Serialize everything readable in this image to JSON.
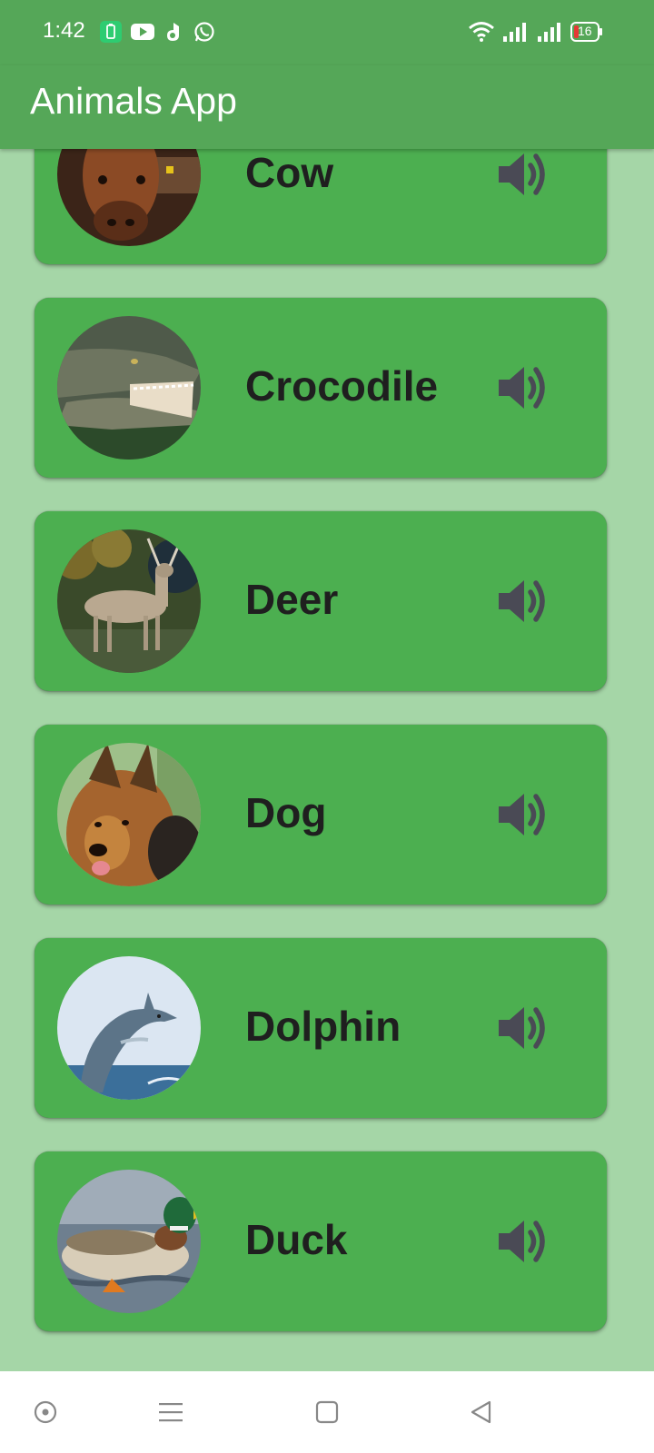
{
  "status_bar": {
    "time": "1:42",
    "battery_level": "16",
    "notification_icons": [
      "battery-saver-icon",
      "youtube-icon",
      "app-notification-icon",
      "whatsapp-icon"
    ],
    "system_icons": [
      "wifi-icon",
      "signal-icon",
      "signal-icon",
      "battery-icon"
    ]
  },
  "app_bar": {
    "title": "Animals App"
  },
  "colors": {
    "app_bar": "#55a758",
    "card": "#4caf50",
    "background": "#a5d6a7",
    "icon": "#4a4a55",
    "text": "#1f1f1f"
  },
  "animals": [
    {
      "name": "Cow",
      "image": "cow-photo",
      "sound_icon": "volume-up-icon"
    },
    {
      "name": "Crocodile",
      "image": "crocodile-photo",
      "sound_icon": "volume-up-icon"
    },
    {
      "name": "Deer",
      "image": "deer-photo",
      "sound_icon": "volume-up-icon"
    },
    {
      "name": "Dog",
      "image": "dog-photo",
      "sound_icon": "volume-up-icon"
    },
    {
      "name": "Dolphin",
      "image": "dolphin-photo",
      "sound_icon": "volume-up-icon"
    },
    {
      "name": "Duck",
      "image": "duck-photo",
      "sound_icon": "volume-up-icon"
    }
  ],
  "nav_bar": {
    "buttons": [
      "assistant-icon",
      "menu-icon",
      "home-icon",
      "back-icon"
    ]
  }
}
